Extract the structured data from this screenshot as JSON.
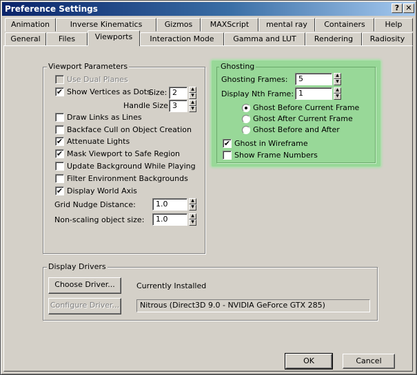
{
  "window": {
    "title": "Preference Settings",
    "help_glyph": "?",
    "close_glyph": "✕"
  },
  "tabs": {
    "row1": [
      "Animation",
      "Inverse Kinematics",
      "Gizmos",
      "MAXScript",
      "mental ray",
      "Containers",
      "Help"
    ],
    "row2": [
      "General",
      "Files",
      "Viewports",
      "Interaction Mode",
      "Gamma and LUT",
      "Rendering",
      "Radiosity"
    ],
    "active": "Viewports"
  },
  "viewport_parameters": {
    "legend": "Viewport Parameters",
    "use_dual_planes": {
      "label": "Use Dual Planes",
      "checked": false,
      "enabled": false
    },
    "show_vertices": {
      "label": "Show Vertices as Dots",
      "checked": true
    },
    "size_label": "Size:",
    "size_value": "2",
    "handle_size_label": "Handle Size:",
    "handle_size_value": "3",
    "draw_links": {
      "label": "Draw Links as Lines",
      "checked": false
    },
    "backface_cull": {
      "label": "Backface Cull on Object Creation",
      "checked": false
    },
    "attenuate_lights": {
      "label": "Attenuate Lights",
      "checked": true
    },
    "mask_viewport": {
      "label": "Mask Viewport to Safe Region",
      "checked": true
    },
    "update_background": {
      "label": "Update Background While Playing",
      "checked": false
    },
    "filter_env": {
      "label": "Filter Environment Backgrounds",
      "checked": false
    },
    "display_world_axis": {
      "label": "Display World Axis",
      "checked": true
    },
    "grid_nudge_label": "Grid Nudge Distance:",
    "grid_nudge_value": "1.0",
    "non_scaling_label": "Non-scaling object size:",
    "non_scaling_value": "1.0"
  },
  "ghosting": {
    "legend": "Ghosting",
    "ghosting_frames_label": "Ghosting Frames:",
    "ghosting_frames_value": "5",
    "display_nth_label": "Display Nth Frame:",
    "display_nth_value": "1",
    "radio_before": "Ghost Before Current Frame",
    "radio_after": "Ghost After Current Frame",
    "radio_both": "Ghost Before and After",
    "selected_radio": "before",
    "ghost_wireframe": {
      "label": "Ghost in Wireframe",
      "checked": true
    },
    "show_frame_numbers": {
      "label": "Show Frame Numbers",
      "checked": false
    },
    "highlight_color": "#98d898"
  },
  "display_drivers": {
    "legend": "Display Drivers",
    "choose_driver": "Choose Driver...",
    "configure_driver": "Configure Driver...",
    "currently_installed_label": "Currently Installed",
    "installed_driver": "Nitrous (Direct3D 9.0 - NVIDIA GeForce GTX 285)"
  },
  "footer": {
    "ok": "OK",
    "cancel": "Cancel"
  },
  "check_glyph": "✔"
}
